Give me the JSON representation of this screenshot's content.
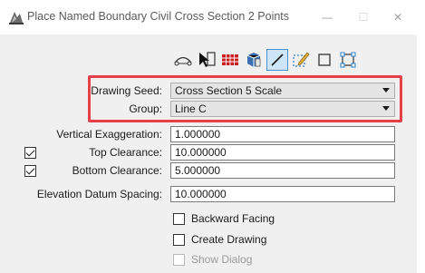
{
  "window": {
    "title": "Place Named Boundary Civil Cross Section 2 Points",
    "minimize_glyph": "—",
    "maximize_glyph": "☐",
    "close_glyph": "✕"
  },
  "toolbar": {
    "tools": [
      {
        "name": "arc-boundary-icon"
      },
      {
        "name": "element-select-icon"
      },
      {
        "name": "grid-icon"
      },
      {
        "name": "view-cube-icon"
      },
      {
        "name": "two-point-line-icon",
        "active": true
      },
      {
        "name": "pencil-select-icon"
      },
      {
        "name": "rectangle-icon"
      },
      {
        "name": "shape-corners-icon"
      }
    ]
  },
  "form": {
    "drawing_seed": {
      "label": "Drawing Seed:",
      "value": "Cross Section 5 Scale"
    },
    "group": {
      "label": "Group:",
      "value": "Line C"
    },
    "vertical_exaggeration": {
      "label": "Vertical Exaggeration:",
      "value": "1.000000"
    },
    "top_clearance": {
      "label": "Top Clearance:",
      "value": "10.000000",
      "checked": true
    },
    "bottom_clearance": {
      "label": "Bottom Clearance:",
      "value": "5.000000",
      "checked": true
    },
    "elevation_datum_spacing": {
      "label": "Elevation Datum Spacing:",
      "value": "10.000000"
    },
    "backward_facing": {
      "label": "Backward Facing",
      "checked": false
    },
    "create_drawing": {
      "label": "Create Drawing",
      "checked": false
    },
    "show_dialog": {
      "label": "Show Dialog",
      "checked": false,
      "disabled": true
    }
  },
  "colors": {
    "highlight": "#e8404b",
    "active_tool": "#cde5f7",
    "dialog_bg": "#f0f0f0"
  }
}
